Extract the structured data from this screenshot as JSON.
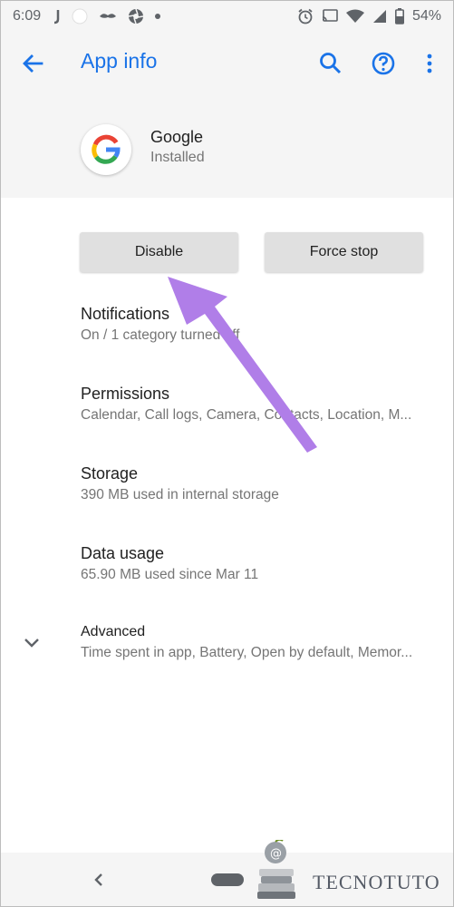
{
  "status_bar": {
    "time": "6:09",
    "battery": "54%",
    "icons_left": [
      "j-notification-icon",
      "circle-notification-icon",
      "mustache-notification-icon",
      "aperture-notification-icon",
      "dot-notification-icon"
    ],
    "icons_right": [
      "alarm-icon",
      "cast-icon",
      "wifi-icon",
      "signal-icon",
      "battery-icon"
    ]
  },
  "app_bar": {
    "title": "App info",
    "accent_color": "#1a73e8",
    "icons": [
      "back-arrow-icon",
      "search-icon",
      "help-icon",
      "overflow-menu-icon"
    ]
  },
  "app": {
    "name": "Google",
    "status": "Installed",
    "icon": "google-g-logo"
  },
  "buttons": {
    "disable": "Disable",
    "force_stop": "Force stop"
  },
  "prefs": [
    {
      "title": "Notifications",
      "subtitle": "On / 1 category turned off"
    },
    {
      "title": "Permissions",
      "subtitle": "Calendar, Call logs, Camera, Contacts, Location, M..."
    },
    {
      "title": "Storage",
      "subtitle": "390 MB used in internal storage"
    },
    {
      "title": "Data usage",
      "subtitle": "65.90 MB used since Mar 11"
    }
  ],
  "advanced": {
    "title": "Advanced",
    "subtitle": "Time spent in app, Battery, Open by default, Memor...",
    "icon": "chevron-down-icon"
  },
  "nav_bar": {
    "icons": [
      "nav-back-icon",
      "nav-home-pill"
    ]
  },
  "annotation": {
    "arrow_color": "#b07ee8"
  },
  "watermark": {
    "text": "TECNOTUTO"
  }
}
